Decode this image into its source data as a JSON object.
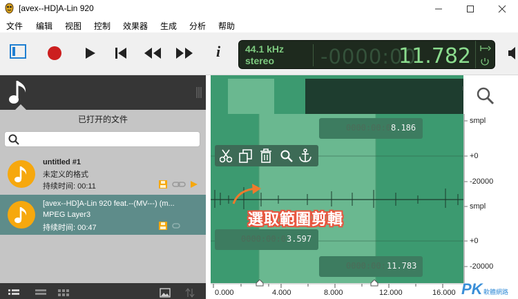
{
  "window": {
    "title": "[avex--HD]A-Lin 920",
    "controls": {
      "minimize": "minimize",
      "maximize": "maximize",
      "close": "close"
    }
  },
  "menu": [
    "文件",
    "编辑",
    "视图",
    "控制",
    "效果器",
    "生成",
    "分析",
    "帮助"
  ],
  "toolbar": {
    "info_label": "i",
    "display": {
      "sample_rate": "44.1 kHz",
      "channels": "stereo",
      "time_ghost": "-0000:00",
      "time": "11.782"
    }
  },
  "left_panel": {
    "title": "已打开的文件",
    "search": {
      "value": "",
      "placeholder": ""
    },
    "files": [
      {
        "name": "untitled #1",
        "format": "未定义的格式",
        "duration": "持续时间: 00:11",
        "selected": false
      },
      {
        "name": "[avex--HD]A-Lin 920 feat.--(MV---) (m...",
        "format": "MPEG Layer3",
        "duration": "持续时间: 00:47",
        "selected": true
      }
    ]
  },
  "waveform": {
    "selection_start_ghost": "0000:00:0",
    "selection_start": "3.597",
    "selection_end_ghost": "0000:00:",
    "selection_end": "11.783",
    "cursor_ghost": "0000:00:0",
    "cursor": "8.186",
    "selection_tools": [
      "cut-icon",
      "copy-icon",
      "delete-icon",
      "zoom-icon",
      "anchor-icon"
    ],
    "amplitude_labels": [
      "smpl",
      "+0",
      "-20000",
      "smpl",
      "+0",
      "-20000"
    ],
    "time_labels": [
      "0.000",
      "4.000",
      "8.000",
      "12.000",
      "16.000"
    ]
  },
  "annotation": {
    "caption": "選取範圍剪輯"
  },
  "watermark": {
    "text": "PK",
    "subtext": "軟體網路"
  },
  "colors": {
    "waveform_bg": "#3c9a70",
    "selection": "#6ab890",
    "lcd_bg": "#1e2a1e",
    "lcd_text": "#8bdc8e",
    "accent_orange": "#f6a80e",
    "record_red": "#cc1f1f",
    "caption_outline": "#e8563f"
  }
}
